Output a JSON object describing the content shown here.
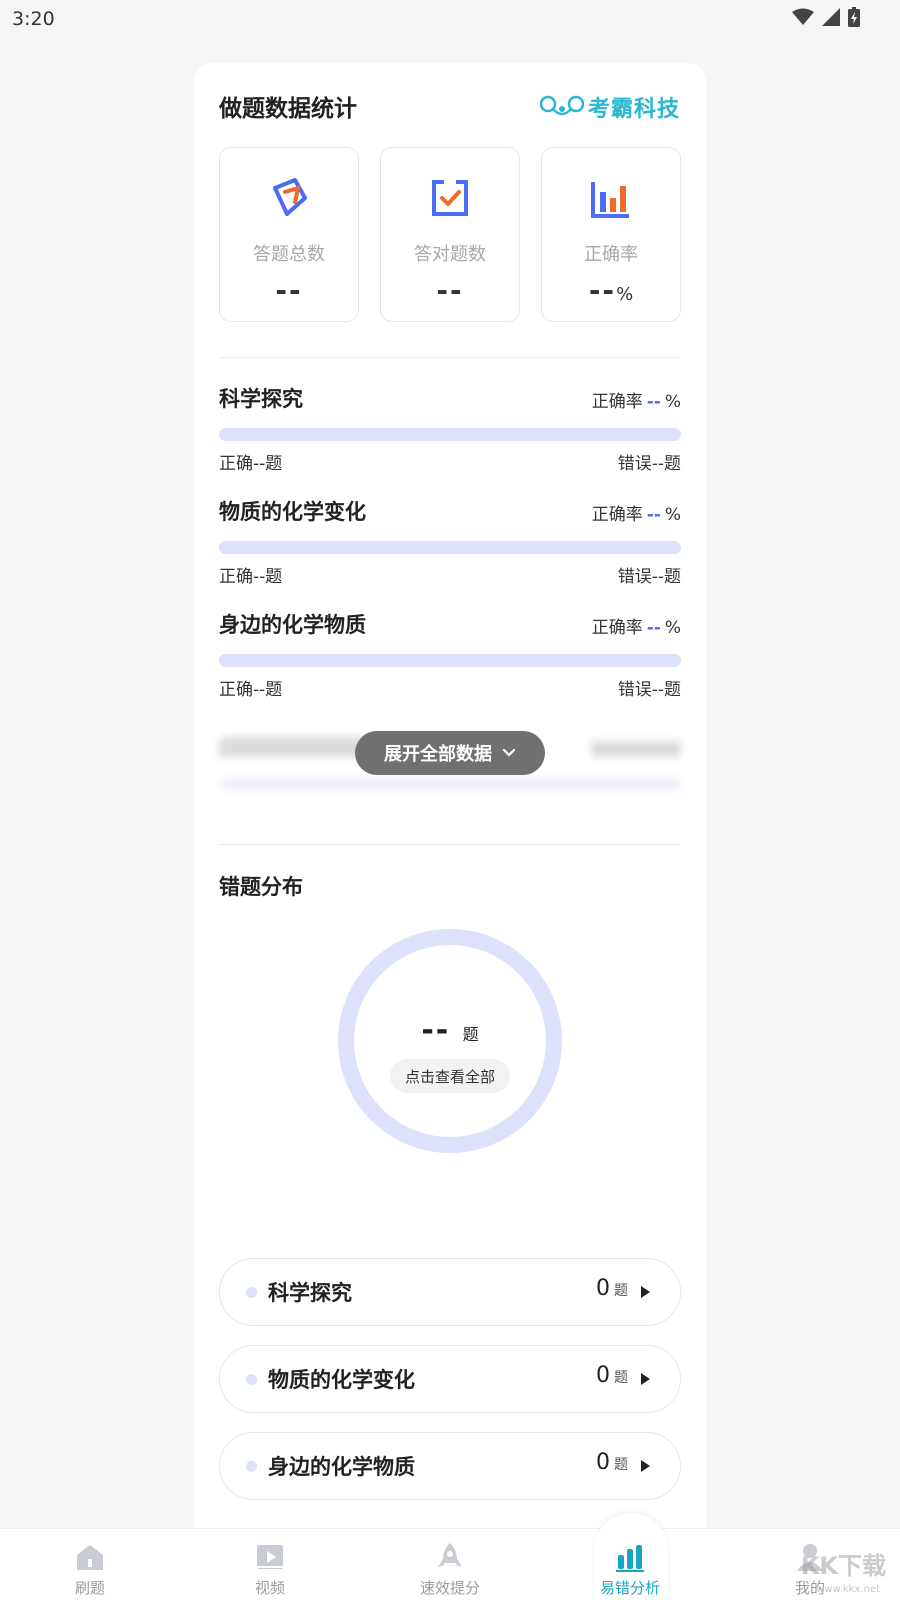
{
  "status_bar": {
    "time": "3:20"
  },
  "card": {
    "title": "做题数据统计",
    "brand": "考霸科技"
  },
  "stats": [
    {
      "label": "答题总数",
      "value": "--",
      "unit": ""
    },
    {
      "label": "答对题数",
      "value": "--",
      "unit": ""
    },
    {
      "label": "正确率",
      "value": "--",
      "unit": "%"
    }
  ],
  "topics": [
    {
      "name": "科学探究",
      "rate_label": "正确率",
      "rate_value": "--",
      "rate_unit": "%",
      "progress": 0,
      "right_text": "正确--题",
      "wrong_text": "错误--题"
    },
    {
      "name": "物质的化学变化",
      "rate_label": "正确率",
      "rate_value": "--",
      "rate_unit": "%",
      "progress": 0,
      "right_text": "正确--题",
      "wrong_text": "错误--题"
    },
    {
      "name": "身边的化学物质",
      "rate_label": "正确率",
      "rate_value": "--",
      "rate_unit": "%",
      "progress": 0,
      "right_text": "正确--题",
      "wrong_text": "错误--题"
    }
  ],
  "expand_button": "展开全部数据",
  "distribution": {
    "title": "错题分布",
    "value": "--",
    "unit": "题",
    "view_all": "点击查看全部"
  },
  "wrong_list": [
    {
      "name": "科学探究",
      "count": "0",
      "unit": "题"
    },
    {
      "name": "物质的化学变化",
      "count": "0",
      "unit": "题"
    },
    {
      "name": "身边的化学物质",
      "count": "0",
      "unit": "题"
    }
  ],
  "tabs": [
    {
      "label": "刷题",
      "icon": "home-icon",
      "active": false
    },
    {
      "label": "视频",
      "icon": "video-icon",
      "active": false
    },
    {
      "label": "速效提分",
      "icon": "rocket-icon",
      "active": false
    },
    {
      "label": "易错分析",
      "icon": "bar-chart-icon",
      "active": true
    },
    {
      "label": "我的",
      "icon": "user-icon",
      "active": false
    }
  ],
  "watermark": {
    "text": "KK下载",
    "sub": "www.kkx.net"
  },
  "colors": {
    "accent": "#4a6cf7",
    "brand": "#29b8d1",
    "bar": "#dde1fb",
    "active_tab": "#1aa5c4"
  }
}
